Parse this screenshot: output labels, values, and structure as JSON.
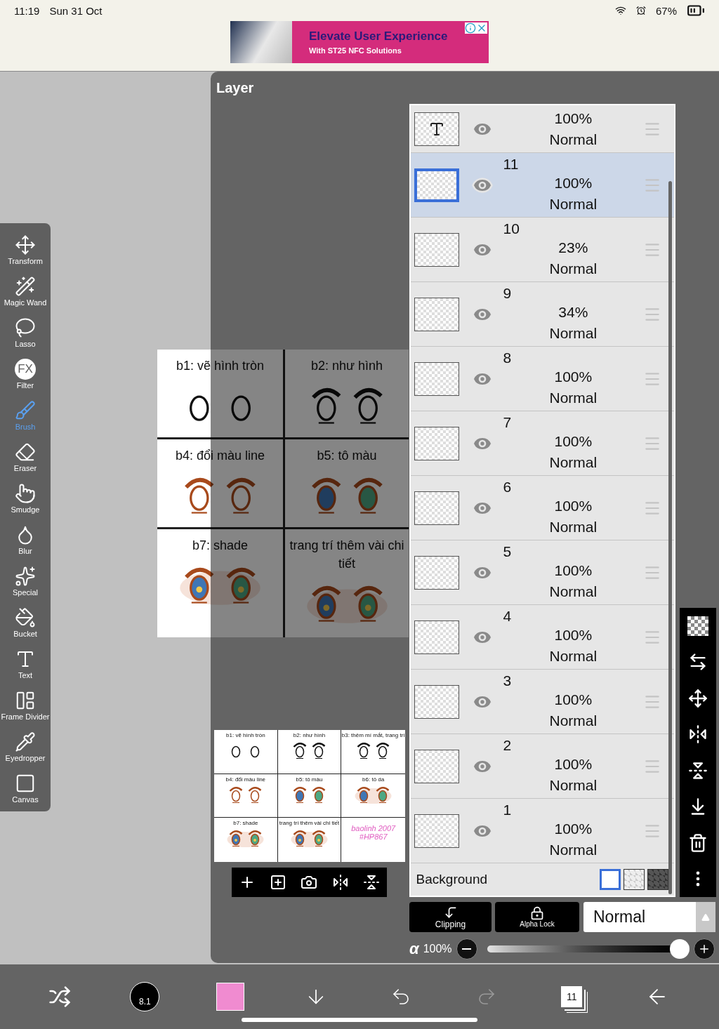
{
  "status_bar": {
    "time": "11:19",
    "date": "Sun 31 Oct",
    "battery": "67%"
  },
  "ad": {
    "headline": "Elevate User Experience",
    "subline": "With ST25 NFC Solutions"
  },
  "tools": [
    {
      "label": "Transform",
      "selected": false
    },
    {
      "label": "Magic Wand",
      "selected": false
    },
    {
      "label": "Lasso",
      "selected": false
    },
    {
      "label": "Filter",
      "selected": false,
      "icon_text": "FX"
    },
    {
      "label": "Brush",
      "selected": true
    },
    {
      "label": "Eraser",
      "selected": false
    },
    {
      "label": "Smudge",
      "selected": false
    },
    {
      "label": "Blur",
      "selected": false
    },
    {
      "label": "Special",
      "selected": false
    },
    {
      "label": "Bucket",
      "selected": false
    },
    {
      "label": "Text",
      "selected": false
    },
    {
      "label": "Frame Divider",
      "selected": false
    },
    {
      "label": "Eyedropper",
      "selected": false
    },
    {
      "label": "Canvas",
      "selected": false
    }
  ],
  "canvas": {
    "panels": [
      {
        "caption": "b1: vẽ hình tròn",
        "kind": "outline"
      },
      {
        "caption": "b2: như hình",
        "kind": "lashes"
      },
      {
        "caption": "b4: đổi màu line",
        "kind": "brown"
      },
      {
        "caption": "b5: tô màu",
        "kind": "color"
      },
      {
        "caption": "b7: shade",
        "kind": "shade"
      },
      {
        "caption": "trang trí thêm vài chi tiết",
        "kind": "detail"
      }
    ]
  },
  "layer_panel": {
    "title": "Layer",
    "thumbnail_panels": [
      {
        "caption": "b1: vẽ hình tròn",
        "kind": "outline"
      },
      {
        "caption": "b2: như hình",
        "kind": "lashes"
      },
      {
        "caption": "b3: thêm mí mắt, trang trí",
        "kind": "lashes"
      },
      {
        "caption": "b4: đổi màu line",
        "kind": "brown"
      },
      {
        "caption": "b5: tô màu",
        "kind": "color"
      },
      {
        "caption": "b6: tô da",
        "kind": "skin"
      },
      {
        "caption": "b7: shade",
        "kind": "shade"
      },
      {
        "caption": "trang trí thêm vài chi tiết",
        "kind": "detail"
      },
      {
        "caption": "baolinh 2007 #HP867",
        "kind": "signature"
      }
    ],
    "layers": [
      {
        "opacity": "100%",
        "blend": "Normal",
        "selected": false,
        "visible": true
      },
      {
        "name": "11",
        "opacity": "100%",
        "blend": "Normal",
        "selected": true,
        "visible": true
      },
      {
        "name": "10",
        "opacity": "23%",
        "blend": "Normal",
        "selected": false,
        "visible": true
      },
      {
        "name": "9",
        "opacity": "34%",
        "blend": "Normal",
        "selected": false,
        "visible": true
      },
      {
        "name": "8",
        "opacity": "100%",
        "blend": "Normal",
        "selected": false,
        "visible": true
      },
      {
        "name": "7",
        "opacity": "100%",
        "blend": "Normal",
        "selected": false,
        "visible": true
      },
      {
        "name": "6",
        "opacity": "100%",
        "blend": "Normal",
        "selected": false,
        "visible": true
      },
      {
        "name": "5",
        "opacity": "100%",
        "blend": "Normal",
        "selected": false,
        "visible": true
      },
      {
        "name": "4",
        "opacity": "100%",
        "blend": "Normal",
        "selected": false,
        "visible": true
      },
      {
        "name": "3",
        "opacity": "100%",
        "blend": "Normal",
        "selected": false,
        "visible": true
      },
      {
        "name": "2",
        "opacity": "100%",
        "blend": "Normal",
        "selected": false,
        "visible": true
      },
      {
        "name": "1",
        "opacity": "100%",
        "blend": "Normal",
        "selected": false,
        "visible": true
      }
    ],
    "background": {
      "label": "Background",
      "options": [
        {
          "kind": "white",
          "selected": true
        },
        {
          "kind": "checker",
          "selected": false
        },
        {
          "kind": "dark",
          "selected": false
        }
      ]
    },
    "clipping": "Clipping",
    "alpha_lock": "Alpha Lock",
    "blend_mode": "Normal",
    "opacity": {
      "symbol": "α",
      "reading": "100%",
      "level": 1
    }
  },
  "bottom_bar": {
    "brush_size": "8.1",
    "color": "#f08bd0",
    "layer_count": "11"
  }
}
